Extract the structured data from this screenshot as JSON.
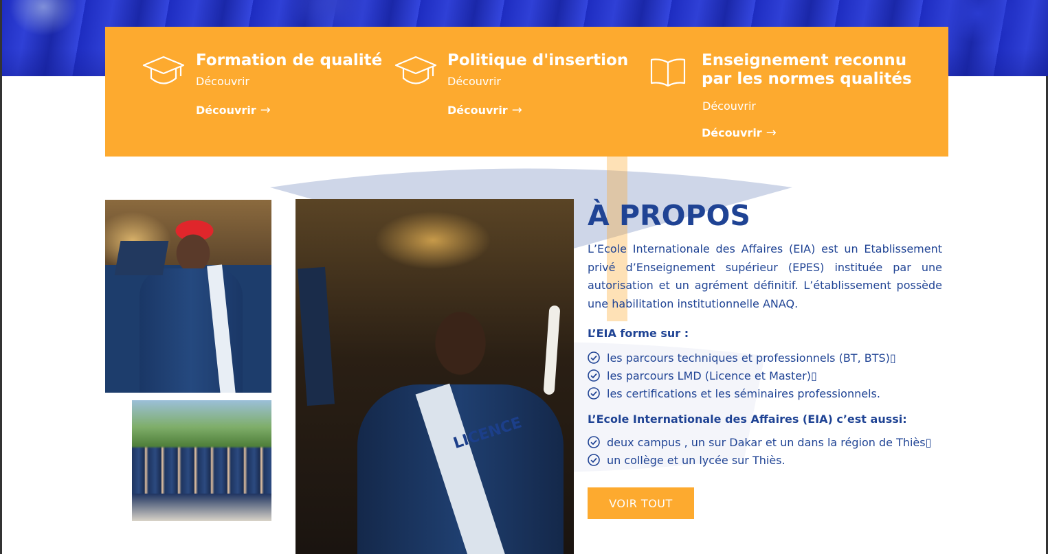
{
  "features": [
    {
      "icon": "graduation-cap-icon",
      "title": "Formation de qualité",
      "subtitle": "Découvrir",
      "link": "Découvrir",
      "arrow": "→"
    },
    {
      "icon": "graduation-cap-icon",
      "title": "Politique d'insertion",
      "subtitle": "Découvrir",
      "link": "Découvrir",
      "arrow": "→"
    },
    {
      "icon": "book-icon",
      "title_line1": "Enseignement reconnu",
      "title_line2": "par les normes qualités",
      "subtitle": "Découvrir",
      "link": "Découvrir",
      "arrow": "→"
    }
  ],
  "about": {
    "heading": "À PROPOS",
    "intro": "L’Ecole Internationale des Affaires (EIA) est un Etablissement privé d’Enseignement supérieur  (EPES) instituée par une autorisation et un agrément définitif. L’établissement possède une habilitation institutionnelle ANAQ.",
    "subhead1": "L’EIA  forme sur :",
    "list1": [
      "les parcours techniques et professionnels (BT, BTS)▯",
      "les parcours LMD (Licence et Master)▯",
      "les certifications et les séminaires professionnels."
    ],
    "subhead2": "L’Ecole Internationale des Affaires (EIA) c’est aussi:",
    "list2": [
      "deux campus , un sur Dakar et un dans la région de Thiès▯",
      "un collège et un lycée sur Thiès."
    ],
    "button": "VOIR TOUT"
  },
  "photos": {
    "sash_text": "LICENCE"
  },
  "colors": {
    "accent_orange": "#fdaa2f",
    "brand_blue": "#1f4394",
    "white": "#ffffff"
  }
}
